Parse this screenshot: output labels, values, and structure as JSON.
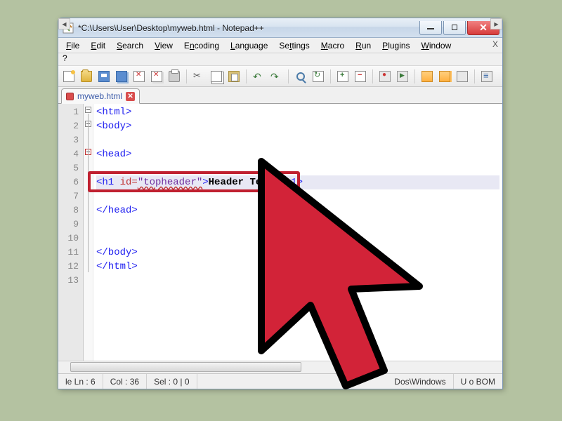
{
  "title": "*C:\\Users\\User\\Desktop\\myweb.html - Notepad++",
  "menus": [
    {
      "label": "File",
      "ul": "F"
    },
    {
      "label": "Edit",
      "ul": "E"
    },
    {
      "label": "Search",
      "ul": "S"
    },
    {
      "label": "View",
      "ul": "V"
    },
    {
      "label": "Encoding",
      "ul": "n"
    },
    {
      "label": "Language",
      "ul": "L"
    },
    {
      "label": "Settings",
      "ul": "t"
    },
    {
      "label": "Macro",
      "ul": "M"
    },
    {
      "label": "Run",
      "ul": "R"
    },
    {
      "label": "Plugins",
      "ul": "P"
    },
    {
      "label": "Window",
      "ul": "W"
    }
  ],
  "question": "?",
  "tab": {
    "label": "myweb.html"
  },
  "lines": [
    "1",
    "2",
    "3",
    "4",
    "5",
    "6",
    "7",
    "8",
    "9",
    "10",
    "11",
    "12",
    "13"
  ],
  "code": {
    "l1": "<html>",
    "l2": "<body>",
    "l3": "",
    "l4": "<head>",
    "l5": "",
    "l6a": "<h1 ",
    "l6b": "id=",
    "l6c": "\"topheader\"",
    "l6d": ">",
    "l6e": "Header Text",
    "l6f": "</h1>",
    "l7": "",
    "l8": "</head>",
    "l9": "",
    "l10": "",
    "l11": "</body>",
    "l12": "</html>",
    "l13": ""
  },
  "status": {
    "ln": "le Ln : 6",
    "col": "Col : 36",
    "sel": "Sel : 0 | 0",
    "eol": "Dos\\Windows",
    "enc": "U           o BOM"
  }
}
